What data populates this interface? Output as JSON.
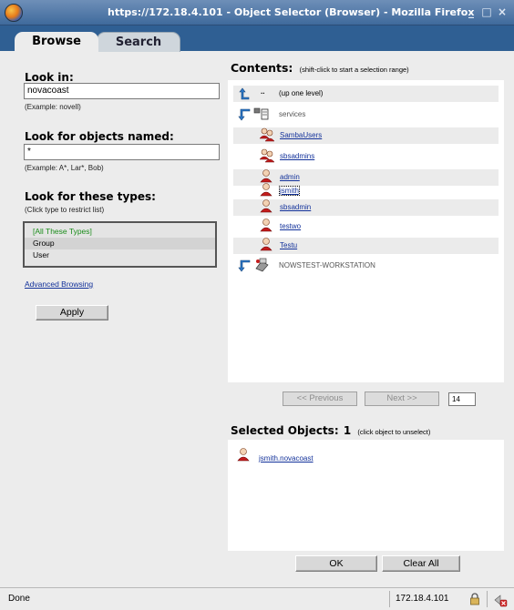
{
  "window": {
    "title": "https://172.18.4.101 - Object Selector (Browser) - Mozilla Firefox"
  },
  "tabs": [
    {
      "label": "Browse"
    },
    {
      "label": "Search"
    }
  ],
  "look_in": {
    "heading": "Look in:",
    "value": "novacoast",
    "example": "(Example: novell)"
  },
  "look_for_named": {
    "heading": "Look for objects named:",
    "value": "*",
    "example": "(Example: A*, Lar*, Bob)"
  },
  "look_for_types": {
    "heading": "Look for these types:",
    "hint": "(Click type to restrict list)",
    "options": [
      "[All These Types]",
      "Group",
      "User"
    ]
  },
  "advanced_browsing": "Advanced Browsing",
  "apply_label": "Apply",
  "contents": {
    "heading": "Contents:",
    "hint": "(shift-click to start a selection range)",
    "items": [
      {
        "marker": "..",
        "label": "(up one level)",
        "icon": "up-arrow-icon"
      },
      {
        "label": "services",
        "icon": "container-icon"
      },
      {
        "label": "SambaUsers",
        "icon": "group-icon"
      },
      {
        "label": "sbsadmins",
        "icon": "group-icon"
      },
      {
        "label": "admin",
        "icon": "user-icon"
      },
      {
        "label": "jsmith",
        "icon": "user-icon"
      },
      {
        "label": "sbsadmin",
        "icon": "user-icon"
      },
      {
        "label": "testwo",
        "icon": "user-icon"
      },
      {
        "label": "Testu",
        "icon": "user-icon"
      },
      {
        "label": "NOWSTEST-WORKSTATION",
        "icon": "workstation-icon"
      }
    ]
  },
  "pager": {
    "previous": "<< Previous",
    "next": "Next >>",
    "page_size": "14"
  },
  "selected": {
    "heading": "Selected Objects:",
    "count": "1",
    "hint": "(click object to unselect)",
    "items": [
      {
        "label": "jsmith.novacoast",
        "icon": "user-icon"
      }
    ]
  },
  "buttons": {
    "ok": "OK",
    "clear_all": "Clear All"
  },
  "status": {
    "text": "Done",
    "host": "172.18.4.101"
  }
}
